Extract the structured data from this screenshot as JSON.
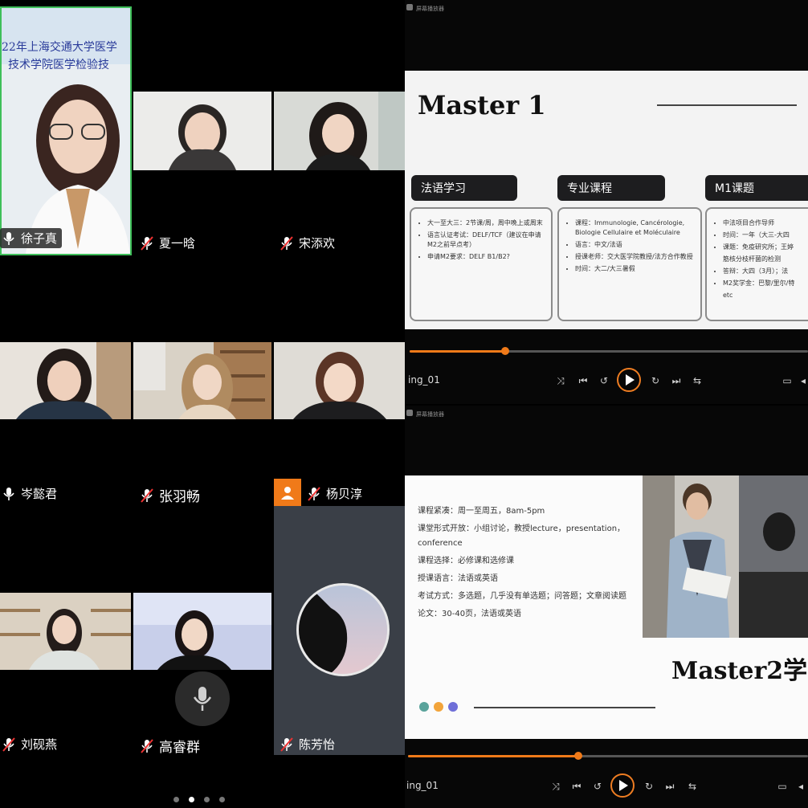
{
  "participants": [
    {
      "name": "徐子真",
      "muted": false,
      "banner": [
        "22年上海交通大学医学",
        "技术学院医学检验技"
      ]
    },
    {
      "name": "夏一晗",
      "muted": true
    },
    {
      "name": "宋添欢",
      "muted": true
    },
    {
      "name": "岑懿君",
      "muted": false
    },
    {
      "name": "张羽畅",
      "muted": true
    },
    {
      "name": "杨贝淳",
      "muted": true
    },
    {
      "name": "刘砚燕",
      "muted": true
    },
    {
      "name": "高睿群",
      "muted": true
    },
    {
      "name": "陈芳怡",
      "muted": true
    }
  ],
  "page_dots": {
    "count": 4,
    "active": 1
  },
  "screens": [
    {
      "window_title": "屏幕播放器",
      "file_name": "ing_01",
      "progress": 0.24,
      "slide": {
        "title": "Master 1",
        "columns": [
          {
            "header": "法语学习",
            "items": [
              "大一至大三：2节课/周，周中晚上或周末",
              "语言认证考试：DELF/TCF（建议在申请M2之前早点考）",
              "申请M2要求：DELF B1/B2?"
            ]
          },
          {
            "header": "专业课程",
            "items": [
              "课程：Immunologie, Cancérologie, Biologie Cellulaire et Moléculaire",
              "语言：中文/法语",
              "授课老师：交大医学院教授/法方合作教授",
              "时间：大二/大三暑假"
            ]
          },
          {
            "header": "M1课题",
            "items": [
              "中法项目合作导师",
              "时间：一年（大三-大四",
              "课题：免疫研究所；王婷",
              "筋核分枝杆菌的检测",
              "答辩：大四（3月）；法",
              "M2奖学金：巴黎/里尔/特",
              "etc"
            ]
          }
        ]
      }
    },
    {
      "window_title": "屏幕播放器",
      "file_name": "ing_01",
      "progress": 0.425,
      "slide": {
        "lines": [
          "课程紧凑：周一至周五，8am-5pm",
          "课堂形式开放：小组讨论，教授lecture，presentation，conference",
          "课程选择：必修课和选修课",
          "授课语言：法语或英语",
          "考试方式：多选题，几乎没有单选题；问答题；文章阅读题",
          "论文：30-40页，法语或英语"
        ],
        "title": "Master2学",
        "dot_colors": [
          "#5aa39b",
          "#f2a43a",
          "#6f6fd8"
        ]
      }
    }
  ],
  "colors": {
    "accent": "#f07a19",
    "active_border": "#3fbf5a",
    "user_icon_bg": "#f07a19"
  }
}
